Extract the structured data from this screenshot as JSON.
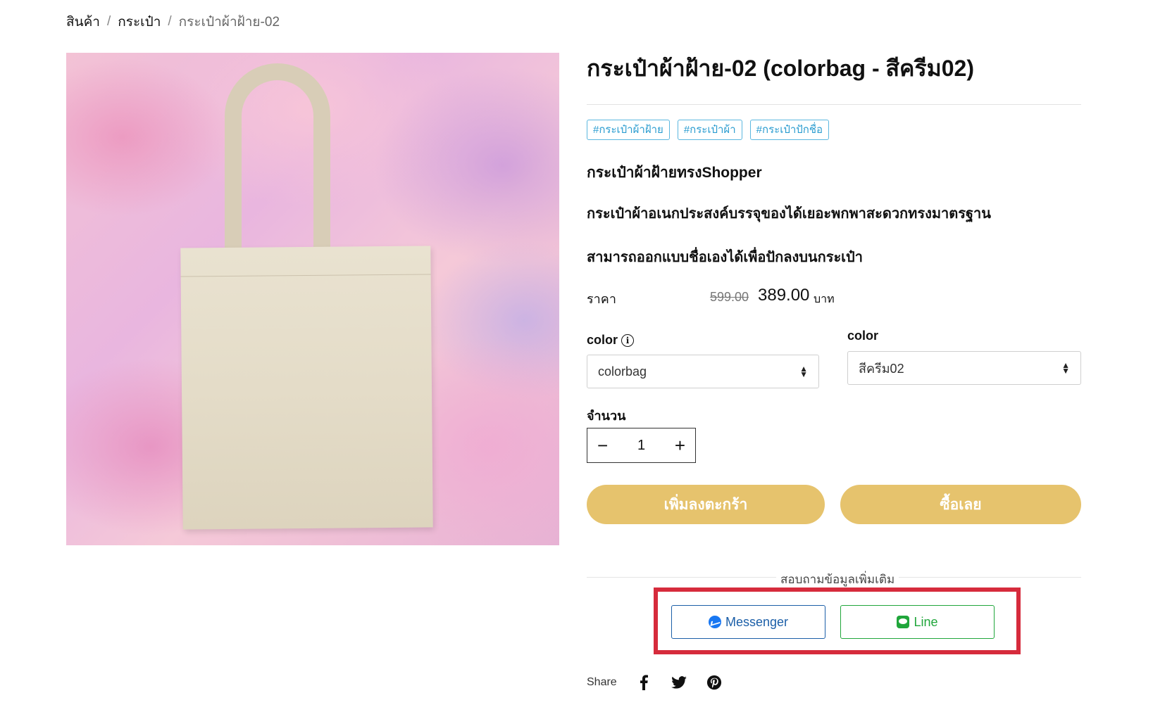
{
  "breadcrumb": {
    "items": [
      "สินค้า",
      "กระเป๋า"
    ],
    "separator": "/",
    "current": "กระเป๋าผ้าฝ้าย-02"
  },
  "product": {
    "title": "กระเป๋าผ้าฝ้าย-02 (colorbag - สีครีม02)",
    "tags": [
      "#กระเป๋าผ้าฝ้าย",
      "#กระเป๋าผ้า",
      "#กระเป๋าปักชื่อ"
    ],
    "subtitle": "กระเป๋าผ้าฝ้ายทรงShopper",
    "description_1": "กระเป๋าผ้าอเนกประสงค์บรรจุของได้เยอะพกพาสะดวกทรงมาตรฐาน",
    "description_2": "สามารถออกแบบชื่อเองได้เพื่อปักลงบนกระเป๋า"
  },
  "price": {
    "label": "ราคา",
    "old": "599.00",
    "current": "389.00",
    "currency": "บาท"
  },
  "options": {
    "option1": {
      "label": "color",
      "value": "colorbag"
    },
    "option2": {
      "label": "color",
      "value": "สีครีม02"
    }
  },
  "quantity": {
    "label": "จำนวน",
    "value": "1",
    "minus": "−",
    "plus": "+"
  },
  "buttons": {
    "add_to_cart": "เพิ่มลงตะกร้า",
    "buy_now": "ซื้อเลย"
  },
  "inquiry": {
    "label": "สอบถามข้อมูลเพิ่มเติม",
    "messenger": "Messenger",
    "line": "Line"
  },
  "share": {
    "label": "Share"
  },
  "colors": {
    "gold": "#e6c36d",
    "tag_blue": "#2a9cd0",
    "messenger_blue": "#1c5fa8",
    "line_green": "#20a63b",
    "highlight_red": "#d62b3c"
  },
  "icons": [
    "info-icon",
    "sort-arrows-icon",
    "messenger-icon",
    "line-icon",
    "facebook-icon",
    "twitter-icon",
    "pinterest-icon"
  ]
}
